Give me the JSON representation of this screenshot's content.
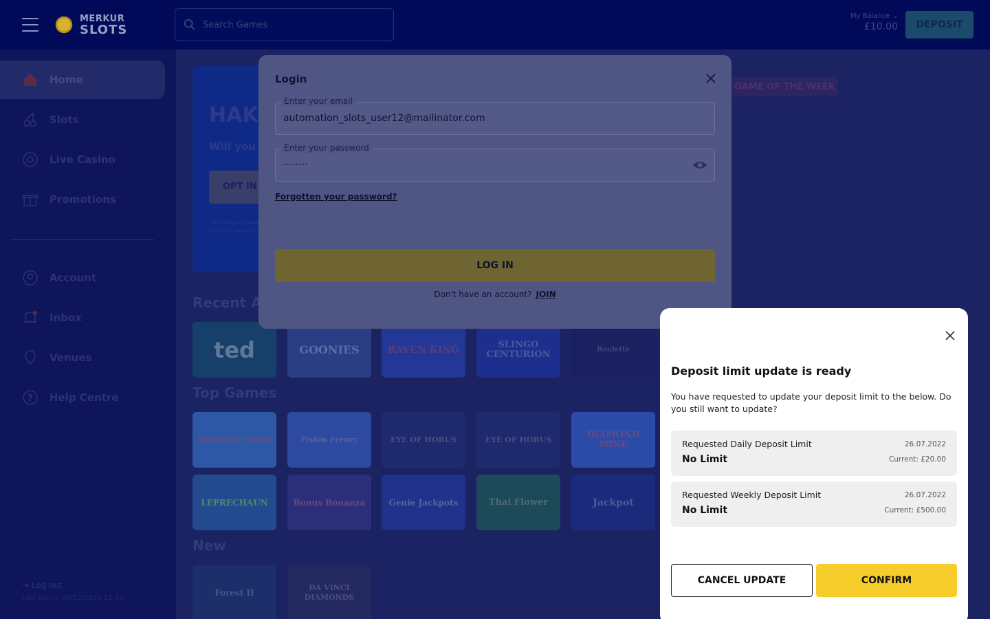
{
  "header": {
    "logo_line1": "MERKUR",
    "logo_line2": "SLOTS",
    "search_placeholder": "Search Games",
    "balance_label": "My Balance",
    "balance_value": "£10.00",
    "deposit_label": "DEPOSIT"
  },
  "sidebar": {
    "items": [
      {
        "label": "Home",
        "icon": "home-icon"
      },
      {
        "label": "Slots",
        "icon": "cherries-icon"
      },
      {
        "label": "Live Casino",
        "icon": "roulette-icon"
      },
      {
        "label": "Promotions",
        "icon": "gift-icon"
      },
      {
        "label": "Account",
        "icon": "user-icon"
      },
      {
        "label": "Inbox",
        "icon": "bell-icon"
      },
      {
        "label": "Venues",
        "icon": "location-pin-icon"
      },
      {
        "label": "Help Centre",
        "icon": "help-icon"
      }
    ],
    "logout": "Log out",
    "last_login": "Last log in: 09/12/2022 11:44"
  },
  "main": {
    "hero_title": "HAK",
    "hero_sub": "Will you",
    "hero_button": "OPT IN",
    "hero_fine_line1": "18+. begambleaware",
    "hero_fine_line2": "with the promotio",
    "game_of_week": "GAME OF THE WEEK",
    "recent_title": "Recent A",
    "top_title": "Top Games",
    "new_title": "New",
    "recent_games": [
      "ted",
      "GOONIES",
      "RAVEN KING",
      "SLINGO CENTURION",
      "Roulette"
    ],
    "top_games_row1": [
      "Rainbow's Riches",
      "Fishin Frenzy",
      "EYE OF HORUS",
      "EYE OF HORUS",
      "DIAMOND MINE"
    ],
    "top_games_row2": [
      "LEPRECHAUN",
      "Bonus Bonanza",
      "Genie Jackpots",
      "Thai Flower",
      "Jackpot"
    ],
    "new_games": [
      "Forest II",
      "DA VINCI DIAMONDS"
    ]
  },
  "login_modal": {
    "title": "Login",
    "email_label": "Enter your email",
    "email_value": "automation_slots_user12@mailinator.com",
    "password_label": "Enter your password",
    "password_value": "········",
    "forgot": "Forgotten your password?",
    "login_button": "LOG IN",
    "no_account": "Don't have an account?",
    "join": "JOIN"
  },
  "deposit_limit": {
    "title": "Deposit limit update is ready",
    "description": "You have requested to update your deposit limit to the below. Do you still want to update?",
    "limits": [
      {
        "name": "Requested Daily Deposit Limit",
        "date": "26.07.2022",
        "value": "No Limit",
        "current": "Current: £20.00"
      },
      {
        "name": "Requested Weekly Deposit Limit",
        "date": "26.07.2022",
        "value": "No Limit",
        "current": "Current: £500.00"
      }
    ],
    "cancel_label": "CANCEL UPDATE",
    "confirm_label": "CONFIRM"
  }
}
